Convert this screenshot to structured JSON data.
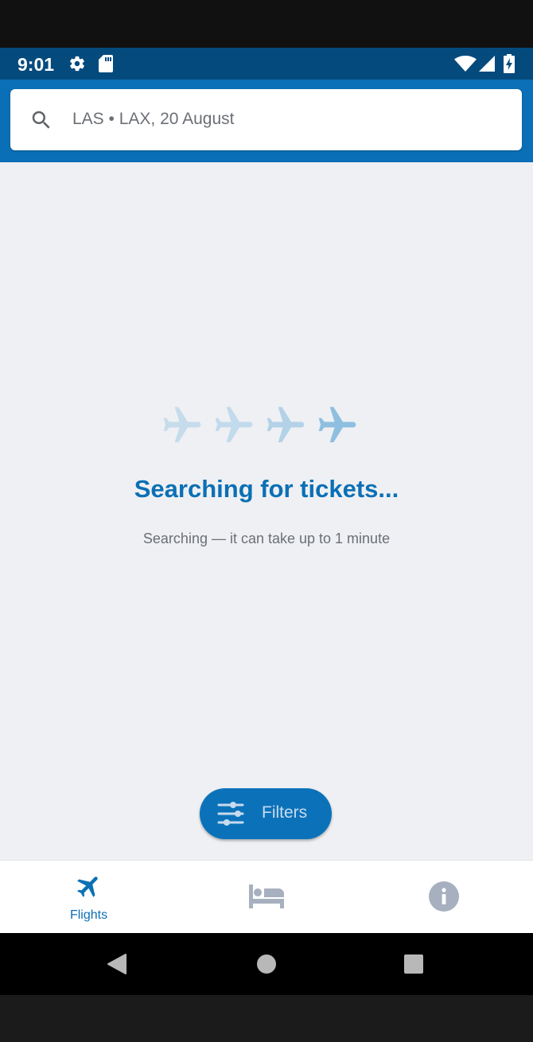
{
  "status_bar": {
    "time": "9:01",
    "icons": [
      "gear-icon",
      "sd-card-icon",
      "wifi-icon",
      "cell-signal-icon",
      "battery-charging-icon"
    ]
  },
  "search": {
    "query": "LAS • LAX, 20 August",
    "icon": "search-icon"
  },
  "loading": {
    "title": "Searching for tickets...",
    "subtitle": "Searching — it can take up to 1 minute",
    "plane_count": 4
  },
  "filters_button": {
    "label": "Filters",
    "icon": "sliders-icon"
  },
  "bottom_nav": {
    "items": [
      {
        "label": "Flights",
        "icon": "airplane-icon",
        "active": true
      },
      {
        "label": "",
        "icon": "bed-icon",
        "active": false
      },
      {
        "label": "",
        "icon": "info-icon",
        "active": false
      }
    ]
  },
  "system_nav": {
    "icons": [
      "back-icon",
      "home-icon",
      "recents-icon"
    ]
  },
  "colors": {
    "brand_blue": "#0a6fb6",
    "status_bar": "#044a7d",
    "background": "#eff0f3",
    "text_muted": "#6b6f76",
    "nav_inactive": "#a7b0bf"
  }
}
